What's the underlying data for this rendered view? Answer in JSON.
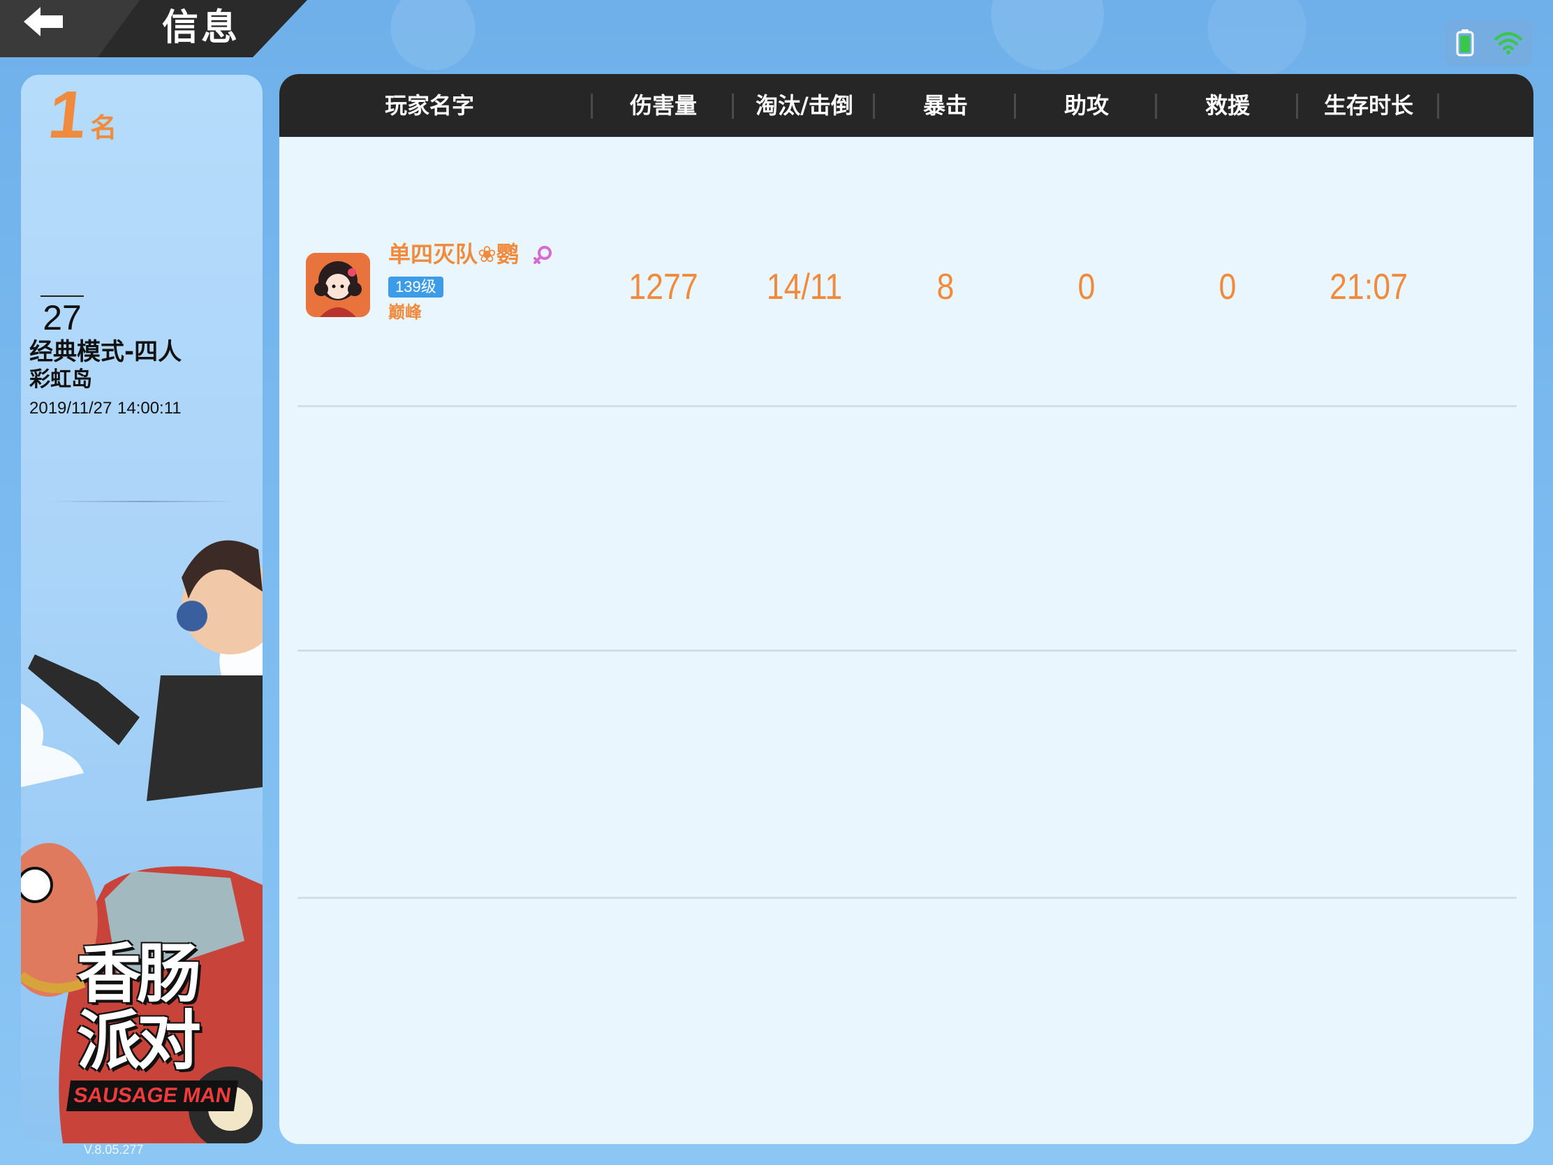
{
  "header": {
    "title": "信息",
    "back_icon": "arrow-left-icon"
  },
  "status": {
    "battery_icon": "battery-icon",
    "wifi_icon": "wifi-icon",
    "battery_color": "#3ac64a",
    "wifi_color": "#3ac64a"
  },
  "match": {
    "rank": "1",
    "rank_unit": "名",
    "players_count": "27",
    "mode": "经典模式-四人",
    "map": "彩虹岛",
    "date": "2019/11/27",
    "time": "14:00:11"
  },
  "branding": {
    "logo_text": "香肠派对",
    "logo_subtitle": "SAUSAGE MAN",
    "version": "V.8.05.277"
  },
  "table": {
    "columns": [
      "玩家名字",
      "伤害量",
      "淘汰/击倒",
      "暴击",
      "助攻",
      "救援",
      "生存时长"
    ],
    "rows": [
      {
        "name": "单四灭队❀鹦",
        "level": "139级",
        "tier": "巅峰",
        "gender_icon": "female-icon",
        "damage": "1277",
        "kills_knockdowns": "14/11",
        "crits": "8",
        "assists": "0",
        "rescues": "0",
        "survival_time": "21:07"
      }
    ]
  },
  "colors": {
    "accent_orange": "#f08a3c",
    "header_dark": "#262626",
    "level_blue": "#3d9ce8",
    "panel_bg": "#eaf6fd"
  }
}
